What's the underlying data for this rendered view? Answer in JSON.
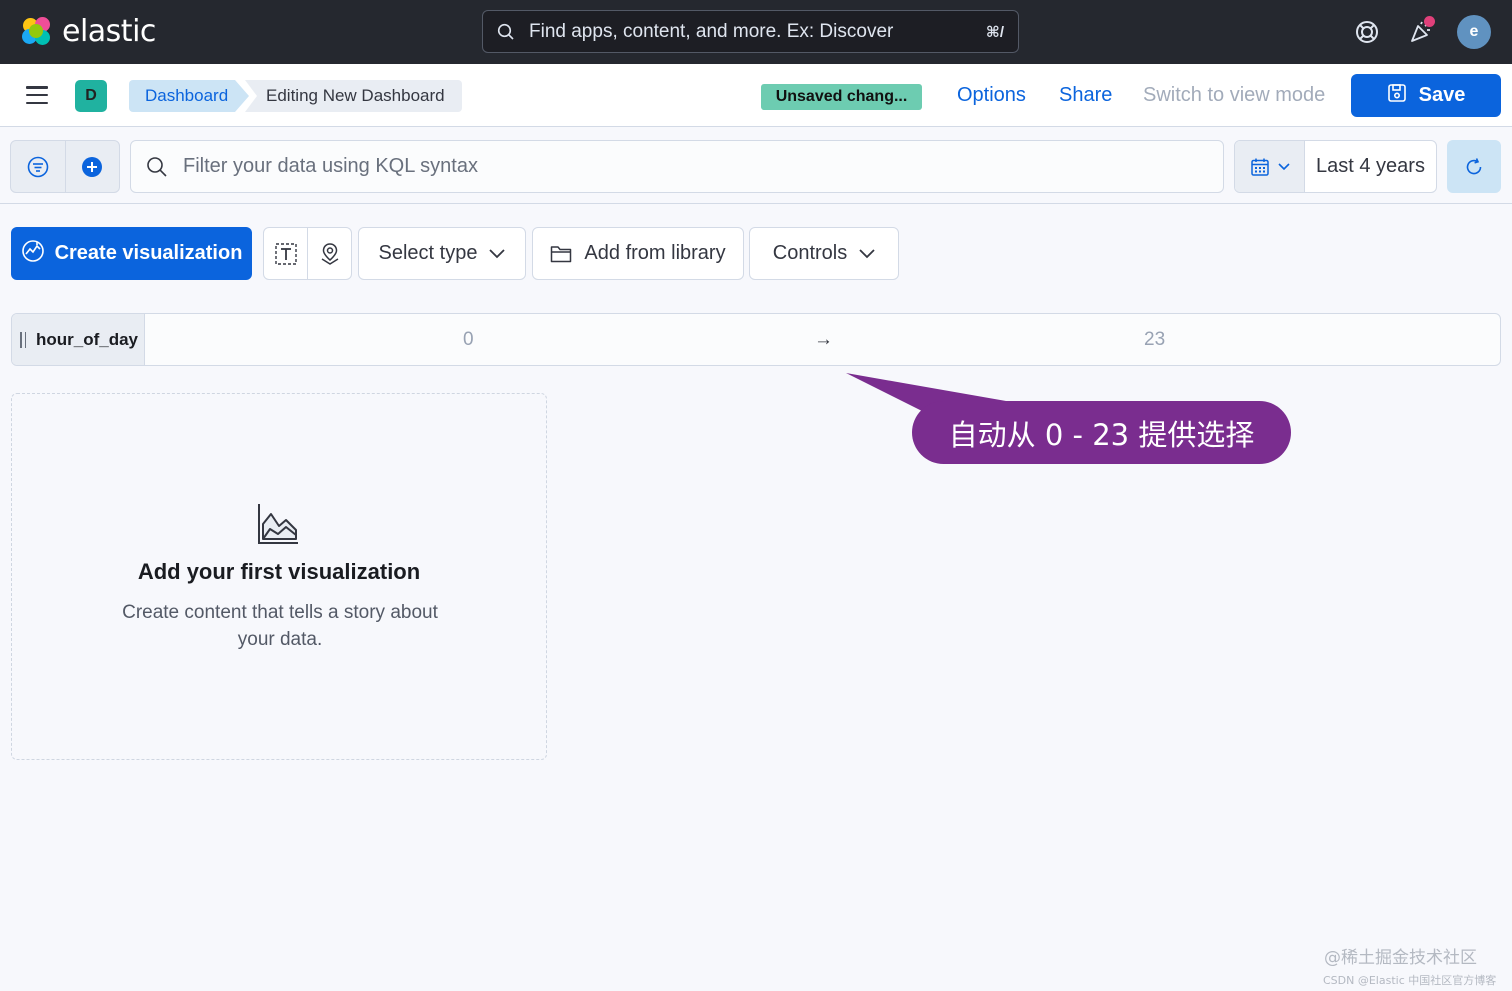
{
  "header": {
    "brand": "elastic",
    "search_placeholder": "Find apps, content, and more. Ex: Discover",
    "search_shortcut": "⌘/",
    "avatar_initial": "e",
    "icons": [
      "help-icon",
      "news-feed-icon"
    ]
  },
  "nav": {
    "space_initial": "D",
    "breadcrumbs": [
      "Dashboard",
      "Editing New Dashboard"
    ],
    "unsaved_badge": "Unsaved chang...",
    "links": {
      "options": "Options",
      "share": "Share",
      "view_mode": "Switch to view mode"
    },
    "save_label": "Save"
  },
  "query": {
    "placeholder": "Filter your data using KQL syntax",
    "time_range": "Last 4 years"
  },
  "toolbar": {
    "create_label": "Create visualization",
    "select_type": "Select type",
    "add_library": "Add from library",
    "controls": "Controls"
  },
  "control": {
    "field": "hour_of_day",
    "min": "0",
    "arrow": "→",
    "max": "23"
  },
  "empty_panel": {
    "title": "Add your first visualization",
    "description": "Create content that tells a story about your data."
  },
  "annotation": {
    "text": "自动从 0 - 23 提供选择"
  },
  "watermark": {
    "line1": "@稀土掘金技术社区",
    "line2": "CSDN @Elastic 中国社区官方博客"
  },
  "colors": {
    "primary": "#0b64dd",
    "header_bg": "#25282f",
    "unsaved_badge": "#6dccb1",
    "callout": "#7a2d8f"
  }
}
